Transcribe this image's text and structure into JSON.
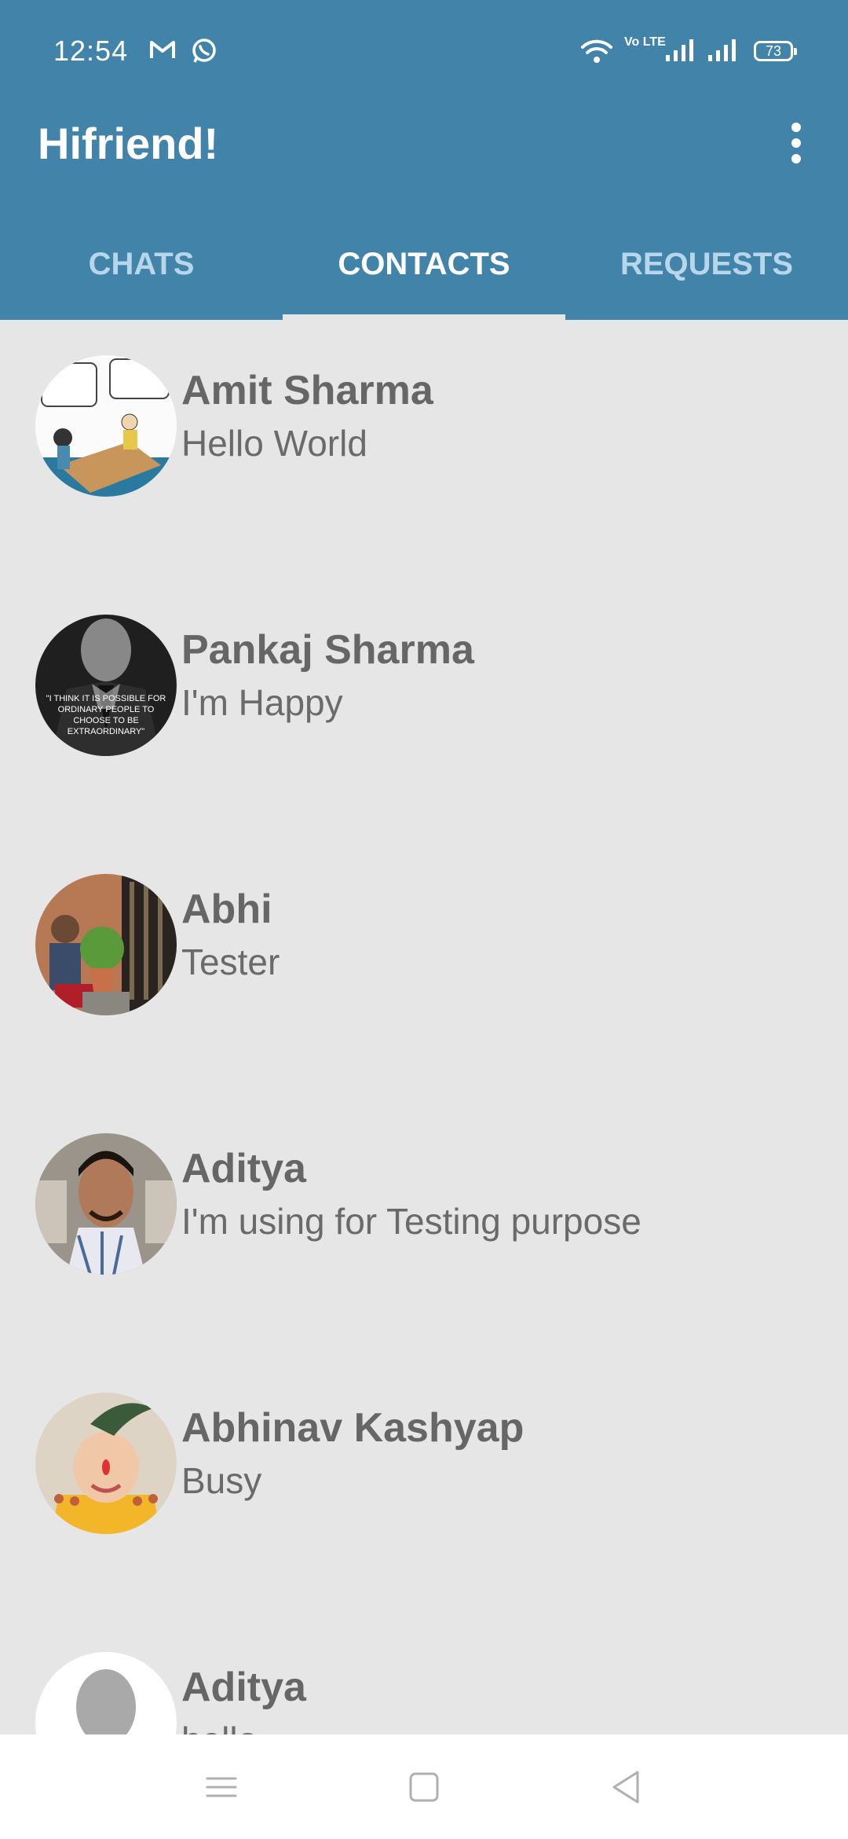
{
  "status_bar": {
    "time": "12:54",
    "volte": "Vo LTE",
    "battery": "73",
    "icons": [
      "gmail-icon",
      "whatsapp-icon",
      "wifi-icon",
      "volte-icon",
      "signal-icon",
      "signal-icon",
      "battery-icon"
    ]
  },
  "app_bar": {
    "title": "Hifriend!",
    "menu_icon": "more-vert-icon",
    "color": "#4283a9"
  },
  "tabs": [
    {
      "label": "CHATS",
      "selected": false
    },
    {
      "label": "CONTACTS",
      "selected": true
    },
    {
      "label": "REQUESTS",
      "selected": false
    }
  ],
  "contacts": [
    {
      "name": "Amit Sharma",
      "status": "Hello World"
    },
    {
      "name": "Pankaj Sharma",
      "status": "I'm Happy",
      "avatar_quote": "\"I THINK IT IS POSSIBLE FOR ORDINARY PEOPLE TO CHOOSE TO BE EXTRAORDINARY\""
    },
    {
      "name": "Abhi",
      "status": "Tester"
    },
    {
      "name": "Aditya",
      "status": "I'm using for Testing purpose"
    },
    {
      "name": "Abhinav Kashyap",
      "status": "Busy"
    },
    {
      "name": "Aditya",
      "status": "hello"
    }
  ],
  "nav_bar": {
    "icons": [
      "menu-icon",
      "home-icon",
      "back-icon"
    ]
  }
}
